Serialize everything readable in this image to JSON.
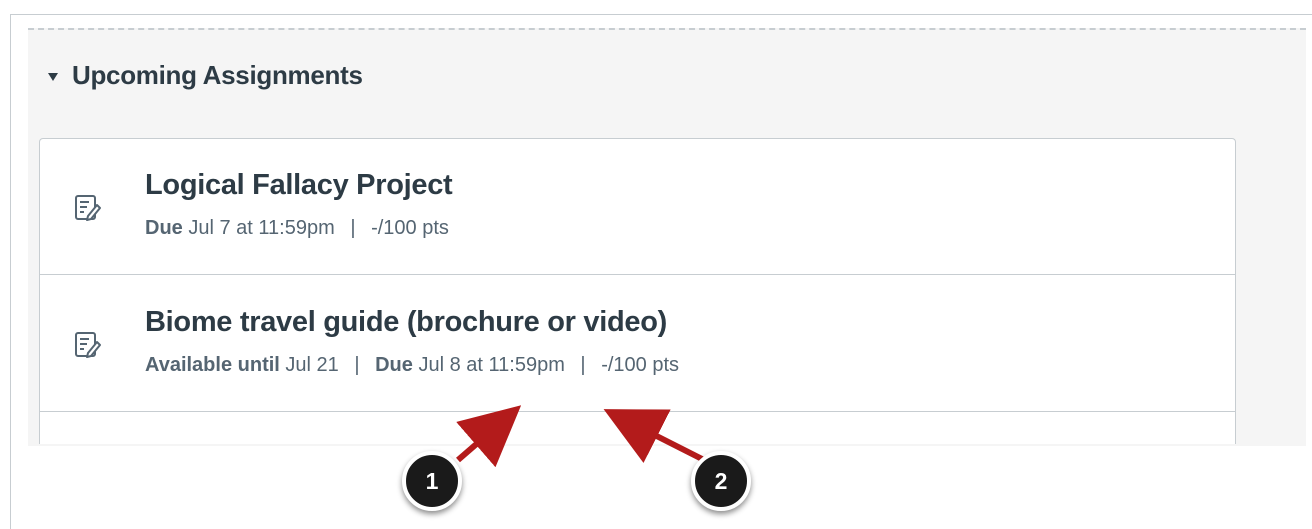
{
  "section": {
    "title": "Upcoming Assignments",
    "toggle_icon": "triangle-down-icon"
  },
  "assignments": [
    {
      "icon": "assignment-icon",
      "title": "Logical Fallacy Project",
      "due_label": "Due",
      "due_value": "Jul 7 at 11:59pm",
      "separator": "|",
      "points": "-/100 pts"
    },
    {
      "icon": "assignment-icon",
      "title": "Biome travel guide (brochure or video)",
      "available_label": "Available until",
      "available_value": "Jul 21",
      "separator": "|",
      "due_label": "Due",
      "due_value": "Jul 8 at 11:59pm",
      "points": "-/100 pts"
    }
  ],
  "callouts": [
    {
      "label": "1",
      "color": "#1a1a1a",
      "arrow_color": "#b31b1b"
    },
    {
      "label": "2",
      "color": "#1a1a1a",
      "arrow_color": "#b31b1b"
    }
  ]
}
